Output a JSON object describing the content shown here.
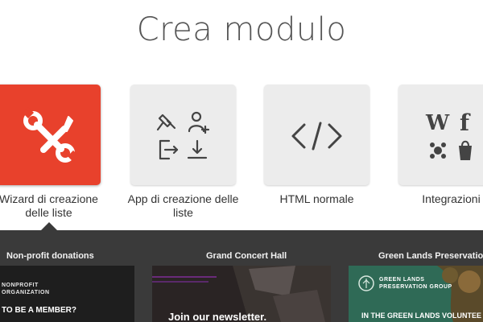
{
  "page_title": "Crea modulo",
  "options": [
    {
      "label_line1": "Wizard di creazione",
      "label_line2": "delle liste",
      "icon": "tools-icon",
      "selected": true
    },
    {
      "label_line1": "App di creazione delle",
      "label_line2": "liste",
      "icon": "apps-icon",
      "selected": false
    },
    {
      "label_line1": "HTML normale",
      "label_line2": "",
      "icon": "code-icon",
      "selected": false
    },
    {
      "label_line1": "Integrazioni",
      "label_line2": "",
      "icon": "integrations-icon",
      "selected": false
    }
  ],
  "templates": [
    {
      "name": "Non-profit donations",
      "preview_org_line1": "NONPROFIT",
      "preview_org_line2": "ORGANIZATION",
      "preview_heading": "TO BE A MEMBER?"
    },
    {
      "name": "Grand Concert Hall",
      "preview_heading": "Join our newsletter."
    },
    {
      "name": "Green Lands Preservation Gr",
      "preview_org_line1": "GREEN LANDS",
      "preview_org_line2": "PRESERVATION GROUP",
      "preview_heading": "IN THE GREEN LANDS VOLUNTEE"
    }
  ],
  "colors": {
    "accent": "#e8412c",
    "tile_bg": "#ececec",
    "panel_bg": "#3a3a3a"
  }
}
